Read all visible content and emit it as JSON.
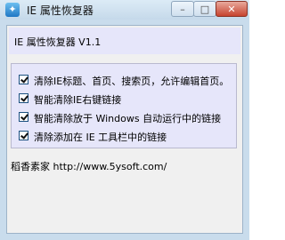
{
  "window": {
    "title": "IE 属性恢复器",
    "app_icon_glyph": "✦",
    "minimize_glyph": "–",
    "maximize_glyph": "□",
    "close_glyph": "✕"
  },
  "banner": {
    "text": "IE 属性恢复器 V1.1"
  },
  "options": [
    {
      "label": "清除IE标题、首页、搜索页，允许编辑首页。",
      "checked": true
    },
    {
      "label": "智能清除IE右键链接",
      "checked": true
    },
    {
      "label": "智能清除放于 Windows 自动运行中的链接",
      "checked": true
    },
    {
      "label": "清除添加在 IE 工具栏中的链接",
      "checked": true
    }
  ],
  "footer": {
    "website_text": "稻香素家 http://www.5ysoft.com/"
  },
  "colors": {
    "frame": "#c9dcec",
    "panel": "#e6e6fa",
    "close_button": "#c7432f"
  }
}
